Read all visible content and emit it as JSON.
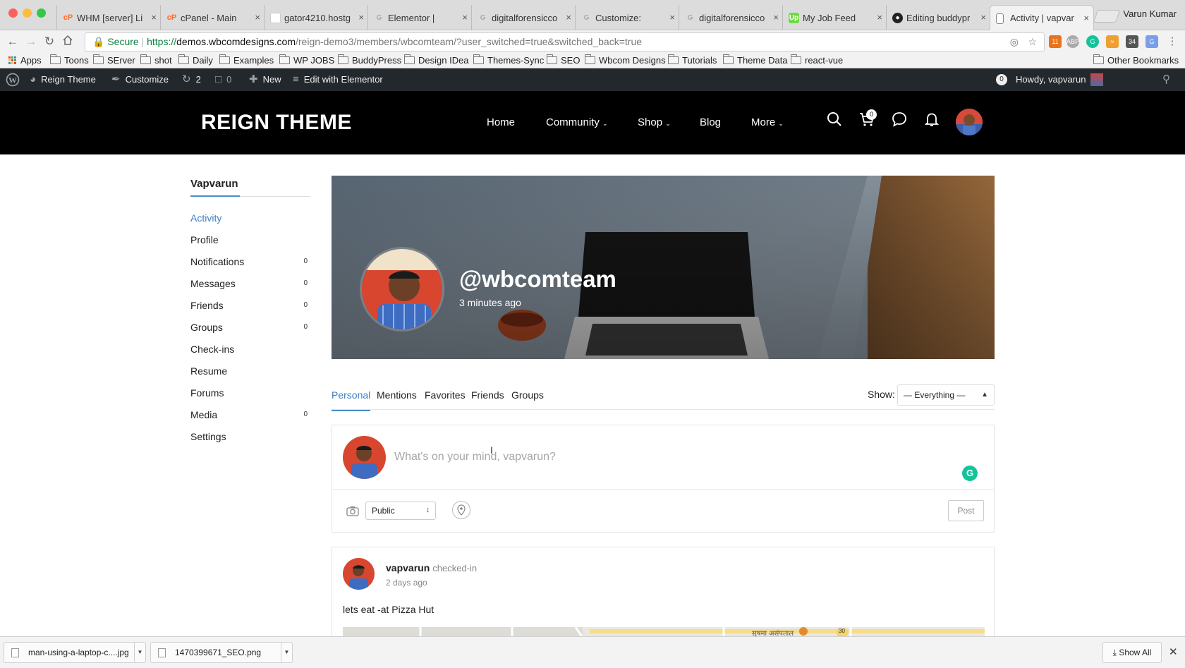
{
  "browser": {
    "tabs": [
      {
        "label": "WHM [server] Li",
        "favicon": "cpanel-icon",
        "color": "#ff6c2c"
      },
      {
        "label": "cPanel - Main",
        "favicon": "cpanel-icon",
        "color": "#ff6c2c"
      },
      {
        "label": "gator4210.hostg",
        "favicon": "hostgator-icon",
        "color": "#f6f6f6"
      },
      {
        "label": "Elementor |",
        "favicon": "globe-icon",
        "color": "#bbbbbb"
      },
      {
        "label": "digitalforensicco",
        "favicon": "globe-icon",
        "color": "#bbbbbb"
      },
      {
        "label": "Customize:",
        "favicon": "globe-icon",
        "color": "#bbbbbb"
      },
      {
        "label": "digitalforensicco",
        "favicon": "globe-icon",
        "color": "#bbbbbb"
      },
      {
        "label": "My Job Feed",
        "favicon": "upwork-icon",
        "color": "#6fda44"
      },
      {
        "label": "Editing buddypr",
        "favicon": "github-icon",
        "color": "#222222"
      },
      {
        "label": "Activity | vapvar",
        "favicon": "page-icon",
        "color": "#ffffff",
        "active": true
      }
    ],
    "profile_name": "Varun Kumar",
    "secure_label": "Secure",
    "url_scheme": "https://",
    "url_host": "demos.wbcomdesigns.com",
    "url_path": "/reign-demo3/members/wbcomteam/?user_switched=true&switched_back=true",
    "bookmarks": [
      "Apps",
      "Toons",
      "SErver",
      "shot",
      "Daily",
      "Examples",
      "WP JOBS",
      "BuddyPress",
      "Design IDea",
      "Themes-Sync",
      "SEO",
      "Wbcom Designs",
      "Tutorials",
      "Theme Data",
      "react-vue"
    ],
    "other_bookmarks": "Other Bookmarks",
    "extension_badge": "11",
    "extension_counter": "34"
  },
  "wpbar": {
    "site": "Reign Theme",
    "customize": "Customize",
    "updates": "2",
    "comments": "0",
    "new": "New",
    "elementor": "Edit with Elementor",
    "notif_count": "0",
    "howdy": "Howdy, vapvarun"
  },
  "site": {
    "logo": "REIGN THEME",
    "nav": [
      "Home",
      "Community",
      "Shop",
      "Blog",
      "More"
    ],
    "cart_count": "0"
  },
  "sidebar": {
    "title": "Vapvarun",
    "items": [
      {
        "label": "Activity",
        "count": ""
      },
      {
        "label": "Profile",
        "count": ""
      },
      {
        "label": "Notifications",
        "count": "0"
      },
      {
        "label": "Messages",
        "count": "0"
      },
      {
        "label": "Friends",
        "count": "0"
      },
      {
        "label": "Groups",
        "count": "0"
      },
      {
        "label": "Check-ins",
        "count": ""
      },
      {
        "label": "Resume",
        "count": ""
      },
      {
        "label": "Forums",
        "count": ""
      },
      {
        "label": "Media",
        "count": "0"
      },
      {
        "label": "Settings",
        "count": ""
      }
    ]
  },
  "cover": {
    "handle": "@wbcomteam",
    "last_active": "3 minutes ago"
  },
  "activity_tabs": [
    "Personal",
    "Mentions",
    "Favorites",
    "Friends",
    "Groups"
  ],
  "filter": {
    "label": "Show:",
    "value": "— Everything —"
  },
  "post_form": {
    "placeholder": "What's on your mind, vapvarun?",
    "privacy": "Public",
    "post_button": "Post",
    "grammarly": "G"
  },
  "activity": {
    "user": "vapvarun",
    "action": "checked-in",
    "time": "2 days ago",
    "content": "lets eat -at Pizza Hut",
    "map_label": "सुषमा असंपताल",
    "map_road": "30"
  },
  "downloads": [
    {
      "name": "man-using-a-laptop-c....jpg"
    },
    {
      "name": "1470399671_SEO.png"
    }
  ],
  "show_all": "Show All",
  "colors": {
    "accent": "#3b7fc4",
    "header": "#000000",
    "wpbar": "#23282d"
  }
}
